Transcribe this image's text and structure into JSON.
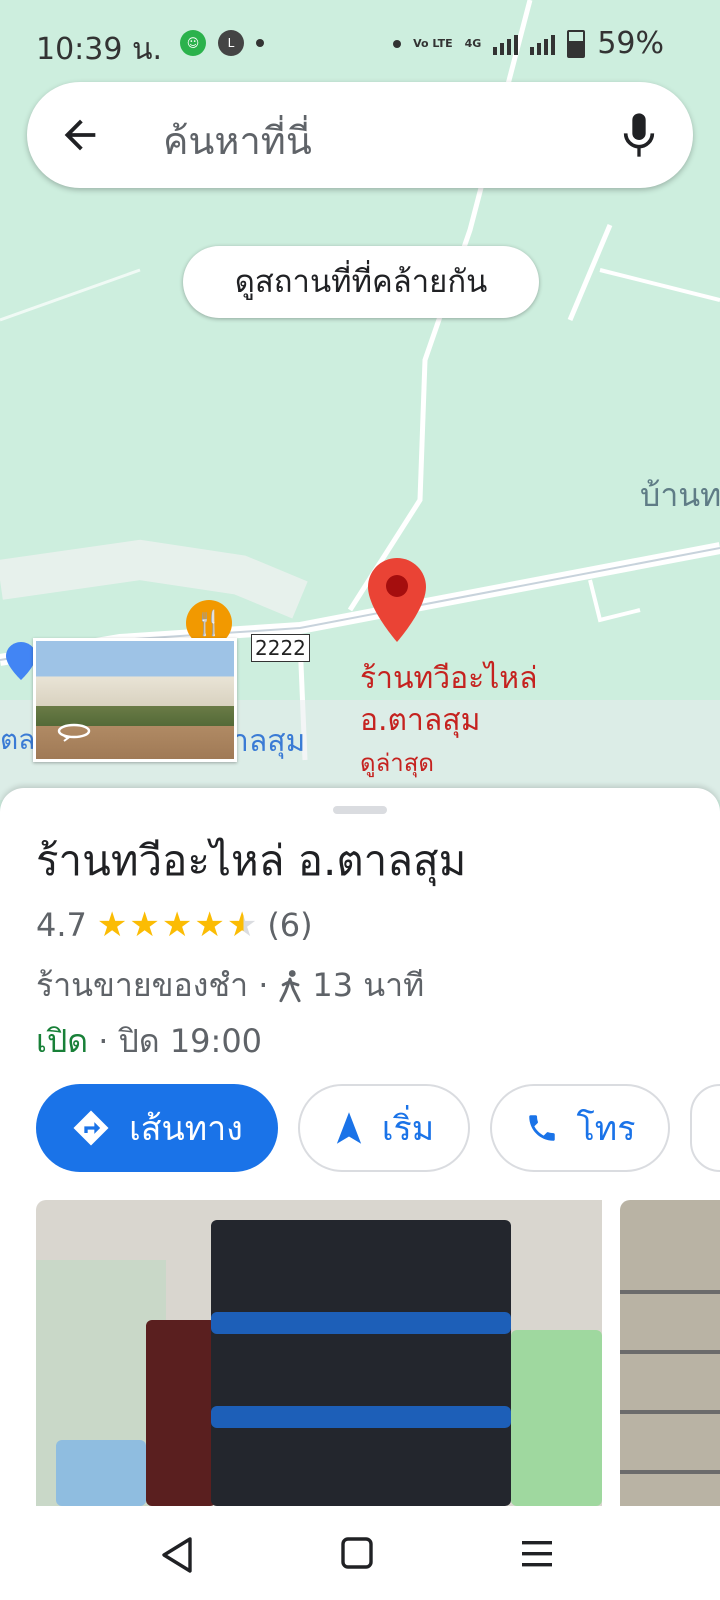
{
  "status_bar": {
    "time": "10:39 น.",
    "battery": "59%",
    "battery_level": 0.59,
    "network": "4G",
    "volte": "Vo LTE"
  },
  "search": {
    "placeholder": "ค้นหาที่นี่"
  },
  "map": {
    "similar_places_chip": "ดูสถานที่ที่คล้ายกัน",
    "labels": {
      "village_partial": "บ้านท",
      "left_partial": "ตล",
      "district_partial": "าลสุม",
      "route_number": "2222"
    },
    "pin": {
      "name_line1": "ร้านทวีอะไหล่",
      "name_line2": "อ.ตาลสุม",
      "sub": "ดูล่าสุด"
    },
    "colors": {
      "park": "#cdeede",
      "pin": "#ea4335",
      "label_red": "#c5221f",
      "label_blue": "#3a7bd5"
    }
  },
  "place": {
    "name": "ร้านทวีอะไหล่ อ.ตาลสุม",
    "rating": "4.7",
    "rating_value": 4.7,
    "review_count": "(6)",
    "category": "ร้านขายของชำ ·",
    "walk_time": "13 นาที",
    "hours_status": "เปิด",
    "hours_detail": "· ปิด 19:00"
  },
  "actions": {
    "directions": "เส้นทาง",
    "start": "เริ่ม",
    "call": "โทร"
  },
  "icons": {
    "back": "arrow-left-icon",
    "mic": "microphone-icon",
    "walk": "walking-person-icon",
    "directions": "directions-icon",
    "start": "navigation-arrow-icon",
    "call": "phone-icon"
  },
  "accent_color": "#1a73e8",
  "open_color": "#188038"
}
